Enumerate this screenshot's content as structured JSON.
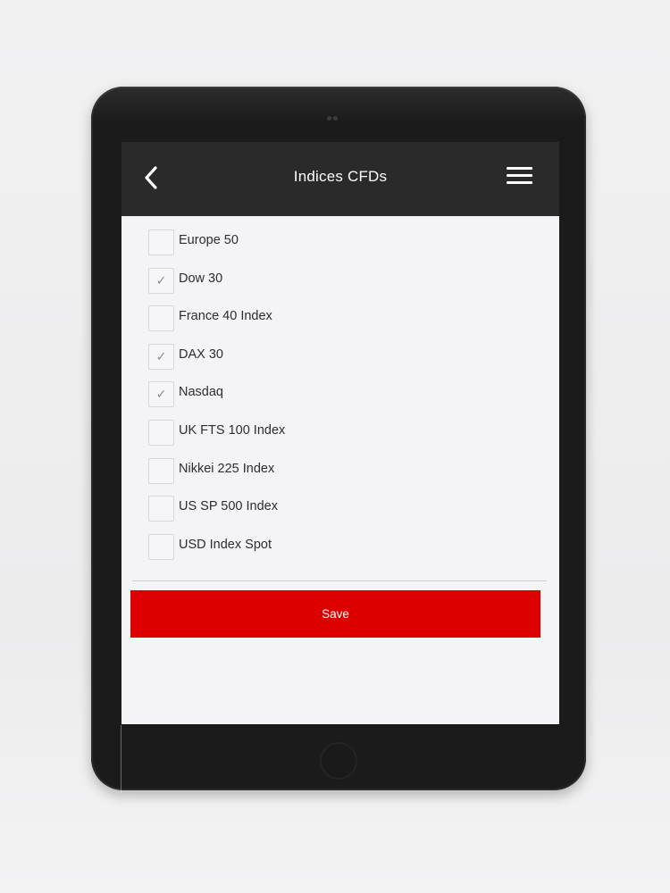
{
  "header": {
    "title": "Indices CFDs",
    "back_icon": "chevron-left-icon",
    "menu_icon": "hamburger-menu-icon"
  },
  "checklist": {
    "items": [
      {
        "label": "Europe 50",
        "checked": false,
        "mark": ""
      },
      {
        "label": "Dow 30",
        "checked": true,
        "mark": "✓"
      },
      {
        "label": "France 40 Index",
        "checked": false,
        "mark": ""
      },
      {
        "label": "DAX 30",
        "checked": true,
        "mark": "✓"
      },
      {
        "label": "Nasdaq",
        "checked": true,
        "mark": "✓"
      },
      {
        "label": "UK FTS 100 Index",
        "checked": false,
        "mark": ""
      },
      {
        "label": "Nikkei 225 Index",
        "checked": false,
        "mark": ""
      },
      {
        "label": "US SP 500 Index",
        "checked": false,
        "mark": ""
      },
      {
        "label": "USD Index Spot",
        "checked": false,
        "mark": ""
      }
    ]
  },
  "actions": {
    "save_label": "Save"
  },
  "colors": {
    "header_bg": "#2b2a2b",
    "accent_red": "#dd0000",
    "screen_bg": "#f4f4f6"
  }
}
